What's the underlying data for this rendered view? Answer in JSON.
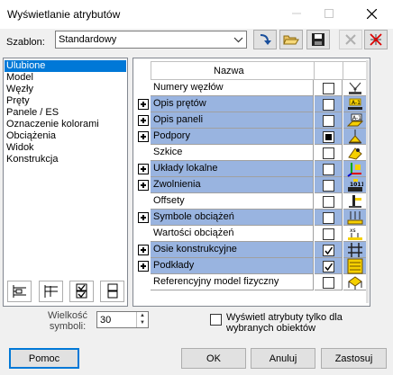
{
  "window": {
    "title": "Wyświetlanie atrybutów",
    "controls": [
      "minimize-icon",
      "maximize-icon",
      "close-icon"
    ]
  },
  "template": {
    "label": "Szablon:",
    "selected": "Standardowy",
    "toolbar": [
      "arrow-down-right-icon",
      "folder-open-icon",
      "save-disk-icon",
      "delete-x-icon",
      "attribute-delete-icon"
    ]
  },
  "categories": [
    {
      "label": "Ulubione",
      "selected": true
    },
    {
      "label": "Model"
    },
    {
      "label": "Węzły"
    },
    {
      "label": "Pręty"
    },
    {
      "label": "Panele / ES"
    },
    {
      "label": "Oznaczenie kolorami"
    },
    {
      "label": "Obciążenia"
    },
    {
      "label": "Widok"
    },
    {
      "label": "Konstrukcja"
    }
  ],
  "grid": {
    "header": "Nazwa",
    "rows": [
      {
        "name": "Numery węzłów",
        "expandable": false,
        "highlighted": false,
        "state": "unchecked",
        "icon": "node-number-icon"
      },
      {
        "name": "Opis prętów",
        "expandable": true,
        "highlighted": true,
        "state": "unchecked",
        "icon": "bar-description-icon"
      },
      {
        "name": "Opis paneli",
        "expandable": true,
        "highlighted": true,
        "state": "unchecked",
        "icon": "panel-description-icon"
      },
      {
        "name": "Podpory",
        "expandable": true,
        "highlighted": true,
        "state": "indeterminate",
        "icon": "support-icon"
      },
      {
        "name": "Szkice",
        "expandable": false,
        "highlighted": false,
        "state": "unchecked",
        "icon": "sketch-icon"
      },
      {
        "name": "Układy lokalne",
        "expandable": true,
        "highlighted": true,
        "state": "unchecked",
        "icon": "local-axes-icon"
      },
      {
        "name": "Zwolnienia",
        "expandable": true,
        "highlighted": true,
        "state": "unchecked",
        "icon": "release-icon"
      },
      {
        "name": "Offsety",
        "expandable": false,
        "highlighted": false,
        "state": "unchecked",
        "icon": "offset-icon"
      },
      {
        "name": "Symbole obciążeń",
        "expandable": true,
        "highlighted": true,
        "state": "unchecked",
        "icon": "load-symbol-icon"
      },
      {
        "name": "Wartości obciążeń",
        "expandable": false,
        "highlighted": false,
        "state": "unchecked",
        "icon": "load-value-icon"
      },
      {
        "name": "Osie konstrukcyjne",
        "expandable": true,
        "highlighted": true,
        "state": "checked",
        "icon": "structural-axis-icon"
      },
      {
        "name": "Podkłady",
        "expandable": true,
        "highlighted": true,
        "state": "checked",
        "icon": "underlay-icon"
      },
      {
        "name": "Referencyjny model fizyczny",
        "expandable": false,
        "highlighted": false,
        "state": "unchecked",
        "icon": "physical-model-icon"
      }
    ]
  },
  "bottom_tools": [
    "expand-all-icon",
    "collapse-all-icon",
    "check-all-icon",
    "uncheck-all-icon"
  ],
  "symbol_size": {
    "label": "Wielkość symboli:",
    "value": "30"
  },
  "selected_only": {
    "label": "Wyświetl atrybuty tylko dla wybranych obiektów",
    "checked": false
  },
  "buttons": {
    "help": "Pomoc",
    "ok": "OK",
    "cancel": "Anuluj",
    "apply": "Zastosuj"
  },
  "colors": {
    "highlight": "#99b4e0",
    "selection": "#0078d7"
  }
}
